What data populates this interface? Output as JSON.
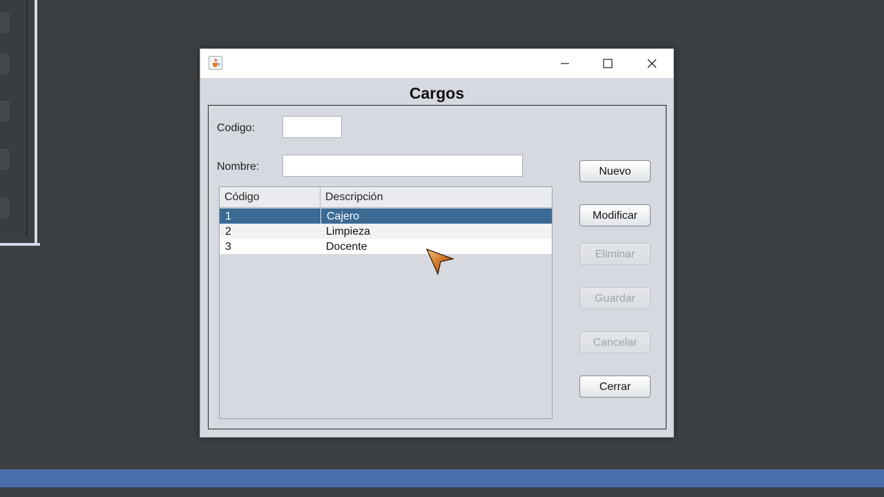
{
  "window": {
    "title": "Cargos",
    "icon": "java-cup-icon",
    "controls": {
      "minimize_icon": "minimize-icon",
      "maximize_icon": "maximize-icon",
      "close_icon": "close-icon"
    }
  },
  "form": {
    "codigo_label": "Codigo:",
    "codigo_value": "",
    "nombre_label": "Nombre:",
    "nombre_value": ""
  },
  "table": {
    "columns": [
      "Código",
      "Descripción"
    ],
    "rows": [
      {
        "codigo": "1",
        "descripcion": "Cajero",
        "selected": true
      },
      {
        "codigo": "2",
        "descripcion": "Limpieza",
        "selected": false
      },
      {
        "codigo": "3",
        "descripcion": "Docente",
        "selected": false
      }
    ]
  },
  "buttons": {
    "nuevo": "Nuevo",
    "modificar": "Modificar",
    "eliminar": "Eliminar",
    "guardar": "Guardar",
    "cancelar": "Cancelar",
    "cerrar": "Cerrar"
  },
  "colors": {
    "selection": "#3b6b94",
    "taskbar": "#4b6eaf",
    "background": "#3c3f41"
  }
}
